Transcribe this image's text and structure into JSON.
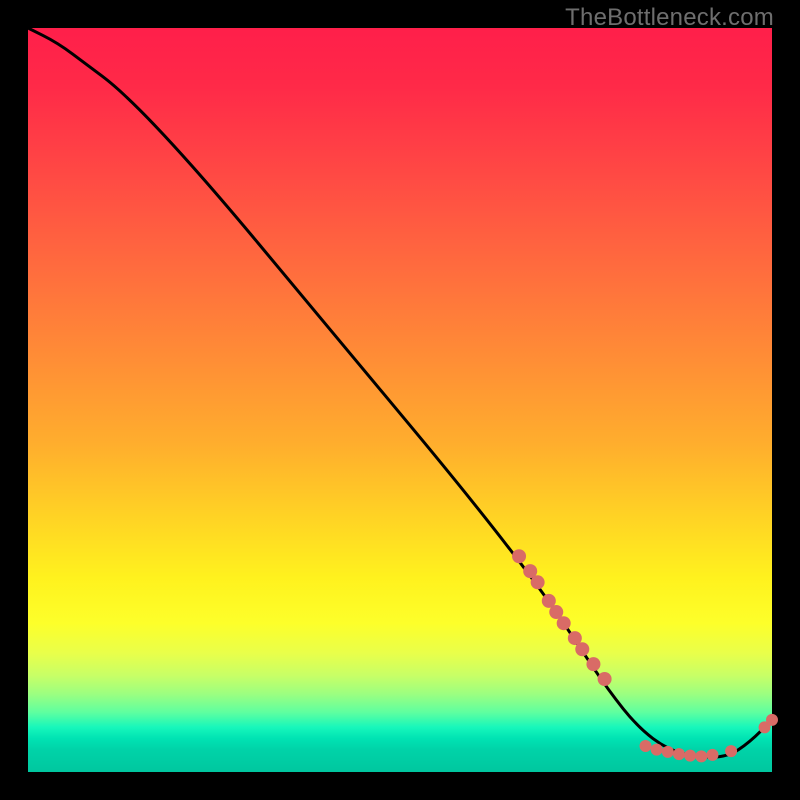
{
  "watermark": "TheBottleneck.com",
  "chart_data": {
    "type": "line",
    "title": "",
    "xlabel": "",
    "ylabel": "",
    "xlim": [
      0,
      100
    ],
    "ylim": [
      0,
      100
    ],
    "grid": false,
    "legend": false,
    "series": [
      {
        "name": "bottleneck-curve",
        "color": "#000000",
        "x": [
          0,
          4,
          8,
          12,
          18,
          26,
          36,
          46,
          56,
          64,
          70,
          74,
          78,
          82,
          86,
          90,
          94,
          97,
          100
        ],
        "y": [
          100,
          98,
          95,
          92,
          86,
          77,
          65,
          53,
          41,
          31,
          23,
          17,
          11,
          6,
          3,
          2,
          2,
          4,
          7
        ]
      }
    ],
    "marker_clusters": [
      {
        "name": "upper-cluster",
        "color": "#d96b66",
        "radius": 7,
        "points": [
          {
            "x": 66,
            "y": 29
          },
          {
            "x": 67.5,
            "y": 27
          },
          {
            "x": 68.5,
            "y": 25.5
          },
          {
            "x": 70,
            "y": 23
          },
          {
            "x": 71,
            "y": 21.5
          },
          {
            "x": 72,
            "y": 20
          },
          {
            "x": 73.5,
            "y": 18
          },
          {
            "x": 74.5,
            "y": 16.5
          },
          {
            "x": 76,
            "y": 14.5
          },
          {
            "x": 77.5,
            "y": 12.5
          }
        ]
      },
      {
        "name": "valley-cluster",
        "color": "#d96b66",
        "radius": 6,
        "points": [
          {
            "x": 83,
            "y": 3.5
          },
          {
            "x": 84.5,
            "y": 3
          },
          {
            "x": 86,
            "y": 2.7
          },
          {
            "x": 87.5,
            "y": 2.4
          },
          {
            "x": 89,
            "y": 2.2
          },
          {
            "x": 90.5,
            "y": 2.1
          },
          {
            "x": 92,
            "y": 2.3
          },
          {
            "x": 94.5,
            "y": 2.8
          }
        ]
      },
      {
        "name": "right-end-cluster",
        "color": "#d96b66",
        "radius": 6,
        "points": [
          {
            "x": 99,
            "y": 6
          },
          {
            "x": 100,
            "y": 7
          }
        ]
      }
    ],
    "gradient_stops": [
      {
        "pos": 0,
        "color": "#ff1f4a"
      },
      {
        "pos": 0.3,
        "color": "#ff6b3e"
      },
      {
        "pos": 0.6,
        "color": "#ffd424"
      },
      {
        "pos": 0.8,
        "color": "#fdff2a"
      },
      {
        "pos": 0.92,
        "color": "#5effa0"
      },
      {
        "pos": 1.0,
        "color": "#00c79f"
      }
    ]
  }
}
